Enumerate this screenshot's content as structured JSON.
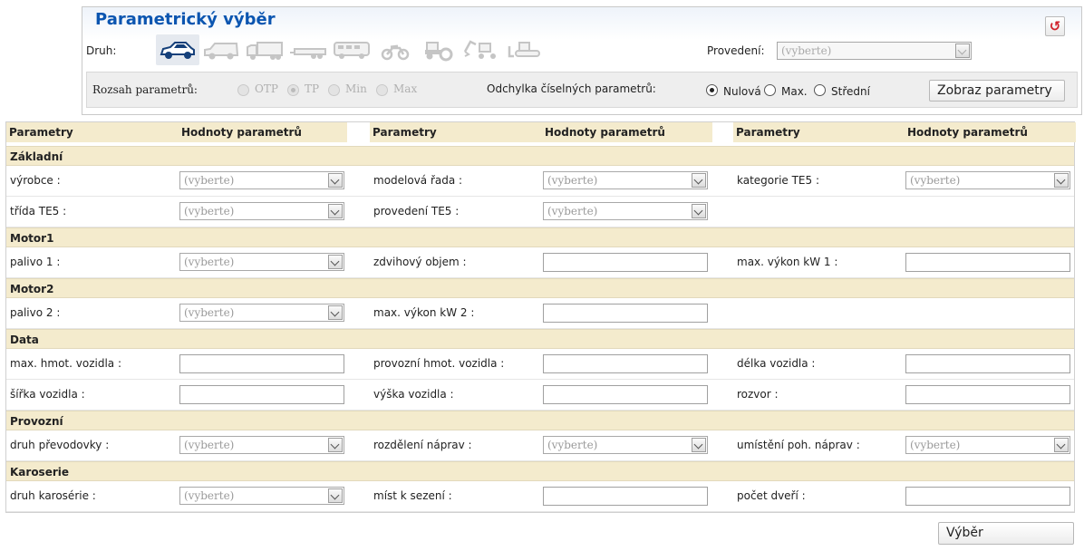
{
  "panel": {
    "title": "Parametrický výběr",
    "druh_label": "Druh:",
    "vehicle_types": [
      {
        "icon": "car-icon",
        "selected": true
      },
      {
        "icon": "van-icon",
        "selected": false
      },
      {
        "icon": "truck-icon",
        "selected": false
      },
      {
        "icon": "trailer-icon",
        "selected": false
      },
      {
        "icon": "bus-icon",
        "selected": false
      },
      {
        "icon": "motorcycle-icon",
        "selected": false
      },
      {
        "icon": "tractor-icon",
        "selected": false
      },
      {
        "icon": "excavator-icon",
        "selected": false
      },
      {
        "icon": "bulldozer-icon",
        "selected": false
      }
    ],
    "provedeni_label": "Provedení:",
    "provedeni_value": "(vyberte)",
    "rozsah_label": "Rozsah parametrů:",
    "rozsah_options": [
      {
        "label": "OTP",
        "checked": false
      },
      {
        "label": "TP",
        "checked": true
      },
      {
        "label": "Min",
        "checked": false
      },
      {
        "label": "Max",
        "checked": false
      }
    ],
    "odchylka_label": "Odchylka číselných parametrů:",
    "odchylka_options": [
      {
        "label": "Nulová",
        "checked": true
      },
      {
        "label": "Max.",
        "checked": false
      },
      {
        "label": "Střední",
        "checked": false
      }
    ],
    "show_button": "Zobraz parametry"
  },
  "table": {
    "headers": [
      "Parametry",
      "Hodnoty parametrů"
    ],
    "placeholder": "(vyberte)",
    "sections": [
      {
        "title": "Základní",
        "rows": [
          [
            {
              "label": "výrobce :",
              "type": "select"
            },
            {
              "label": "modelová řada :",
              "type": "select"
            },
            {
              "label": "kategorie TE5 :",
              "type": "select"
            }
          ],
          [
            {
              "label": "třída TE5 :",
              "type": "select"
            },
            {
              "label": "provedení TE5 :",
              "type": "select"
            },
            null
          ]
        ]
      },
      {
        "title": "Motor1",
        "rows": [
          [
            {
              "label": "palivo 1 :",
              "type": "select"
            },
            {
              "label": "zdvihový objem :",
              "type": "text"
            },
            {
              "label": "max. výkon kW 1 :",
              "type": "text"
            }
          ]
        ]
      },
      {
        "title": "Motor2",
        "rows": [
          [
            {
              "label": "palivo 2 :",
              "type": "select"
            },
            {
              "label": "max. výkon kW 2 :",
              "type": "text"
            },
            null
          ]
        ]
      },
      {
        "title": "Data",
        "rows": [
          [
            {
              "label": "max. hmot. vozidla :",
              "type": "text"
            },
            {
              "label": "provozní hmot. vozidla :",
              "type": "text"
            },
            {
              "label": "délka vozidla :",
              "type": "text"
            }
          ],
          [
            {
              "label": "šířka vozidla :",
              "type": "text"
            },
            {
              "label": "výška vozidla :",
              "type": "text"
            },
            {
              "label": "rozvor :",
              "type": "text"
            }
          ]
        ]
      },
      {
        "title": "Provozní",
        "rows": [
          [
            {
              "label": "druh převodovky :",
              "type": "select"
            },
            {
              "label": "rozdělení náprav :",
              "type": "select"
            },
            {
              "label": "umístění poh. náprav :",
              "type": "select"
            }
          ]
        ]
      },
      {
        "title": "Karoserie",
        "rows": [
          [
            {
              "label": "druh karosérie :",
              "type": "select"
            },
            {
              "label": "míst k sezení :",
              "type": "text"
            },
            {
              "label": "počet dveří :",
              "type": "text"
            }
          ]
        ]
      }
    ]
  },
  "footer": {
    "submit_button": "Výběr"
  }
}
